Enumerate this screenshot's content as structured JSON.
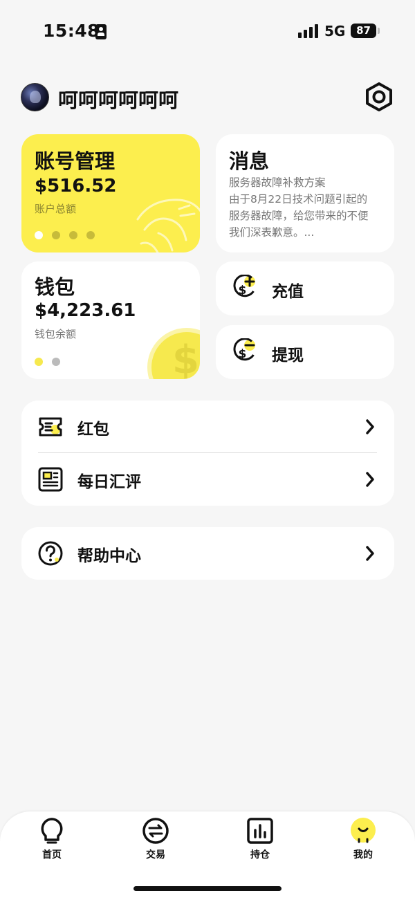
{
  "status_bar": {
    "time": "15:48",
    "network": "5G",
    "battery": "87"
  },
  "header": {
    "username": "呵呵呵呵呵呵"
  },
  "account_card": {
    "title": "账号管理",
    "amount": "$516.52",
    "label": "账户总额"
  },
  "message_card": {
    "title": "消息",
    "lines": [
      "服务器故障补救方案",
      "由于8月22日技术问题引起的",
      "服务器故障，给您带来的不便",
      "我们深表歉意。..."
    ]
  },
  "wallet_card": {
    "title": "钱包",
    "amount": "$4,223.61",
    "label": "钱包余额"
  },
  "actions": {
    "recharge": "充值",
    "withdraw": "提现"
  },
  "list_items": {
    "red_packet": "红包",
    "daily_review": "每日汇评",
    "help_center": "帮助中心"
  },
  "tabs": [
    {
      "label": "首页",
      "icon": "bulb-icon"
    },
    {
      "label": "交易",
      "icon": "exchange-icon"
    },
    {
      "label": "持仓",
      "icon": "bar-chart-icon"
    },
    {
      "label": "我的",
      "icon": "mine-icon"
    }
  ],
  "colors": {
    "accent": "#fcee4e",
    "background": "#f6f6f6",
    "text": "#111111",
    "muted": "#777777"
  }
}
